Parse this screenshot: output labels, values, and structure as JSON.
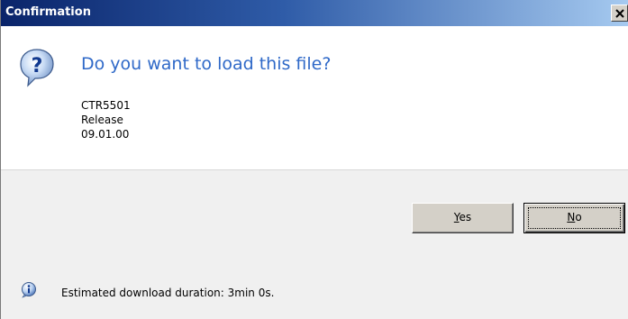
{
  "window": {
    "title": "Confirmation",
    "close_icon": "close-icon"
  },
  "message": {
    "icon": "question-icon",
    "question": "Do you want to load this file?",
    "details": [
      "CTR5501",
      "Release",
      "09.01.00"
    ]
  },
  "buttons": {
    "yes": {
      "mnemonic": "Y",
      "rest": "es"
    },
    "no": {
      "mnemonic": "N",
      "rest": "o"
    }
  },
  "status": {
    "icon": "info-icon",
    "text": "Estimated download duration: 3min 0s."
  },
  "colors": {
    "title_bar_start": "#0a246a",
    "title_bar_end": "#a6caf0",
    "question_text": "#2f69c8",
    "footer_bg": "#f0f0f0"
  }
}
